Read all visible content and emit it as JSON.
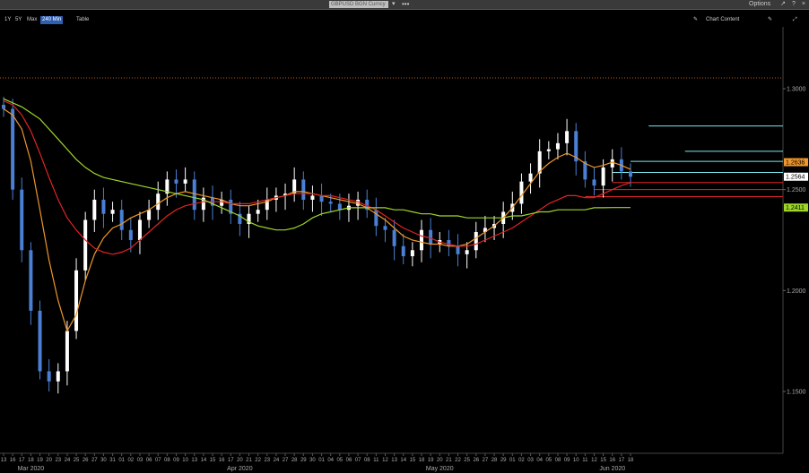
{
  "window": {
    "title_field": "GBPUSD BGN Curncy",
    "caret": "▾",
    "dots": "•••",
    "options_label": "Options",
    "expand_icon": "↗",
    "help_icon": "?",
    "close_icon": "×"
  },
  "toolbar": {
    "ranges": [
      "1Y",
      "5Y",
      "Max"
    ],
    "interval": "240 Min",
    "table_label": "Table",
    "settings_icon": "✎",
    "chart_content_label": "Chart Content",
    "edit_icon": "✎",
    "expand_icon": "⤢"
  },
  "colors": {
    "background": "#000000",
    "candle_up": "#ffffff",
    "candle_down": "#4a7fd4",
    "ma_short": "#f0962a",
    "ma_mid": "#e02424",
    "ma_long": "#9fd62a",
    "level_cyan": "#7fe6ee",
    "level_red": "#e02424",
    "dotted_line": "#b45a1a"
  },
  "chart_data": {
    "type": "line",
    "yticks": [
      "1.3000",
      "1.2500",
      "1.2000",
      "1.1500"
    ],
    "ylim": [
      1.13,
      1.335
    ],
    "price_labels": [
      {
        "text": "1.2636",
        "value": 1.2636,
        "color": "#f0962a"
      },
      {
        "text": "1.2564",
        "value": 1.2564,
        "color": "#ffffff"
      },
      {
        "text": "1.2411",
        "value": 1.2411,
        "color": "#9fd62a"
      }
    ],
    "horizontal_levels": [
      {
        "value": 1.3053,
        "color": "#b45a1a",
        "style": "dotted",
        "from": 0
      },
      {
        "value": 1.2815,
        "color": "#7fe6ee",
        "from": 71
      },
      {
        "value": 1.269,
        "color": "#7fe6ee",
        "from": 75
      },
      {
        "value": 1.264,
        "color": "#7fe6ee",
        "from": 69
      },
      {
        "value": 1.2585,
        "color": "#7fe6ee",
        "from": 67
      },
      {
        "value": 1.2535,
        "color": "#e02424",
        "from": 67
      },
      {
        "value": 1.25,
        "color": "#e02424",
        "from": 65
      },
      {
        "value": 1.2465,
        "color": "#e02424",
        "from": 64
      }
    ],
    "x_day_labels": [
      "13",
      "16",
      "17",
      "18",
      "19",
      "20",
      "23",
      "24",
      "25",
      "26",
      "27",
      "30",
      "31",
      "01",
      "02",
      "03",
      "06",
      "07",
      "08",
      "09",
      "10",
      "13",
      "14",
      "15",
      "16",
      "17",
      "20",
      "21",
      "22",
      "23",
      "24",
      "27",
      "28",
      "29",
      "30",
      "01",
      "04",
      "05",
      "06",
      "07",
      "08",
      "11",
      "12",
      "13",
      "14",
      "15",
      "18",
      "19",
      "20",
      "21",
      "22",
      "25",
      "26",
      "27",
      "28",
      "29",
      "01",
      "02",
      "03",
      "04",
      "05",
      "08",
      "09",
      "10",
      "11",
      "12",
      "15",
      "16",
      "17",
      "18"
    ],
    "x_month_labels": [
      {
        "text": "Mar 2020",
        "index": 3
      },
      {
        "text": "Apr 2020",
        "index": 26
      },
      {
        "text": "May 2020",
        "index": 48
      },
      {
        "text": "Jun 2020",
        "index": 67
      }
    ],
    "close": [
      1.29,
      1.25,
      1.22,
      1.19,
      1.16,
      1.155,
      1.16,
      1.18,
      1.21,
      1.235,
      1.245,
      1.238,
      1.24,
      1.23,
      1.225,
      1.235,
      1.24,
      1.248,
      1.255,
      1.253,
      1.255,
      1.24,
      1.246,
      1.242,
      1.245,
      1.238,
      1.233,
      1.238,
      1.24,
      1.245,
      1.247,
      1.248,
      1.255,
      1.245,
      1.247,
      1.244,
      1.243,
      1.24,
      1.242,
      1.245,
      1.24,
      1.232,
      1.23,
      1.222,
      1.217,
      1.22,
      1.23,
      1.223,
      1.225,
      1.222,
      1.218,
      1.22,
      1.229,
      1.231,
      1.233,
      1.239,
      1.243,
      1.254,
      1.258,
      1.269,
      1.27,
      1.273,
      1.279,
      1.264,
      1.255,
      1.252,
      1.261,
      1.265,
      1.259,
      1.2564
    ],
    "series": [
      {
        "values": [
          1.29,
          1.287,
          1.28,
          1.264,
          1.24,
          1.215,
          1.195,
          1.18,
          1.188,
          1.205,
          1.218,
          1.226,
          1.231,
          1.233,
          1.236,
          1.238,
          1.24,
          1.243,
          1.246,
          1.248,
          1.249,
          1.248,
          1.247,
          1.246,
          1.245,
          1.243,
          1.242,
          1.242,
          1.243,
          1.244,
          1.246,
          1.247,
          1.249,
          1.249,
          1.248,
          1.247,
          1.246,
          1.245,
          1.244,
          1.243,
          1.241,
          1.238,
          1.235,
          1.231,
          1.227,
          1.225,
          1.224,
          1.223,
          1.223,
          1.222,
          1.222,
          1.223,
          1.226,
          1.229,
          1.232,
          1.236,
          1.241,
          1.247,
          1.253,
          1.259,
          1.263,
          1.266,
          1.268,
          1.266,
          1.263,
          1.261,
          1.262,
          1.2636,
          1.262,
          1.26
        ]
      },
      {
        "values": [
          1.294,
          1.292,
          1.287,
          1.279,
          1.268,
          1.256,
          1.245,
          1.236,
          1.23,
          1.225,
          1.221,
          1.219,
          1.218,
          1.219,
          1.221,
          1.225,
          1.229,
          1.233,
          1.237,
          1.24,
          1.242,
          1.243,
          1.244,
          1.244,
          1.244,
          1.243,
          1.243,
          1.243,
          1.244,
          1.245,
          1.246,
          1.247,
          1.248,
          1.248,
          1.248,
          1.247,
          1.247,
          1.246,
          1.245,
          1.244,
          1.242,
          1.24,
          1.237,
          1.234,
          1.231,
          1.229,
          1.227,
          1.226,
          1.224,
          1.223,
          1.222,
          1.222,
          1.223,
          1.225,
          1.227,
          1.229,
          1.231,
          1.234,
          1.237,
          1.24,
          1.243,
          1.245,
          1.247,
          1.247,
          1.246,
          1.246,
          1.248,
          1.25,
          1.252,
          1.2535
        ]
      },
      {
        "values": [
          1.295,
          1.293,
          1.291,
          1.288,
          1.285,
          1.28,
          1.275,
          1.27,
          1.265,
          1.261,
          1.258,
          1.256,
          1.255,
          1.254,
          1.253,
          1.252,
          1.251,
          1.25,
          1.249,
          1.248,
          1.247,
          1.246,
          1.245,
          1.243,
          1.241,
          1.239,
          1.237,
          1.234,
          1.232,
          1.231,
          1.23,
          1.23,
          1.231,
          1.233,
          1.236,
          1.238,
          1.239,
          1.24,
          1.241,
          1.241,
          1.241,
          1.241,
          1.241,
          1.24,
          1.24,
          1.239,
          1.238,
          1.238,
          1.237,
          1.237,
          1.237,
          1.236,
          1.236,
          1.236,
          1.236,
          1.236,
          1.237,
          1.237,
          1.238,
          1.239,
          1.239,
          1.24,
          1.24,
          1.24,
          1.24,
          1.241,
          1.241,
          1.2411,
          1.2411,
          1.2411
        ]
      }
    ]
  }
}
